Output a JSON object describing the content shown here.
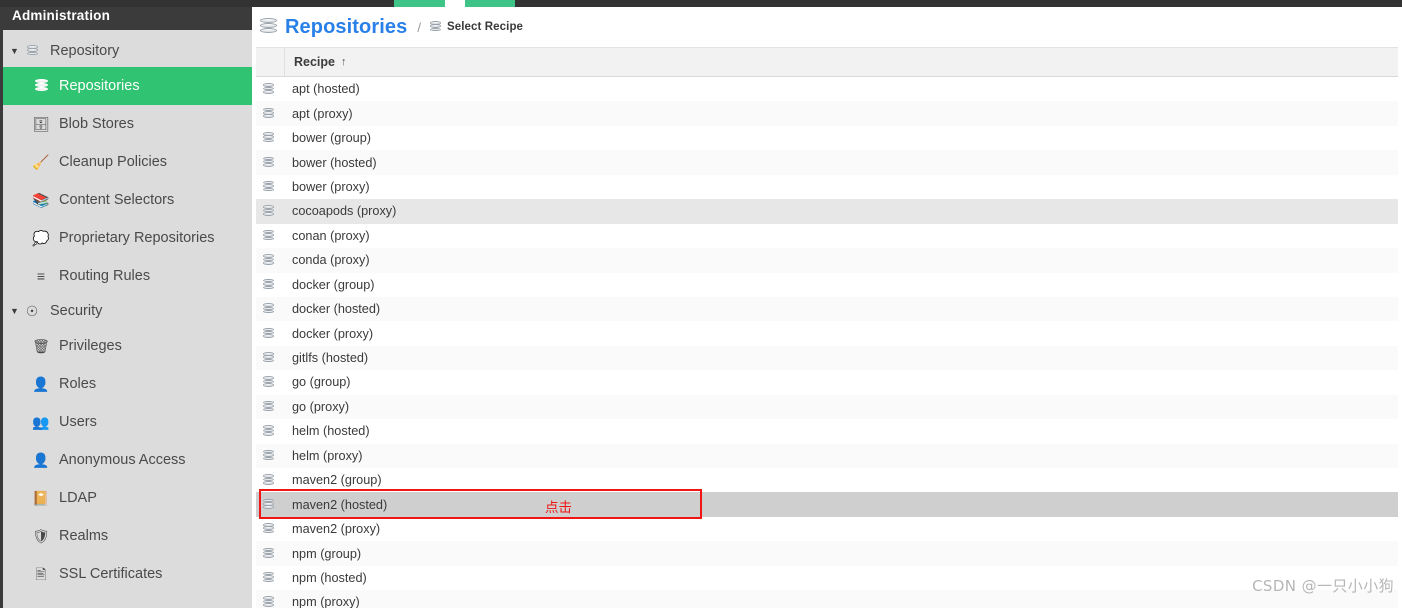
{
  "sidebar": {
    "title": "Administration",
    "groups": [
      {
        "label": "Repository",
        "icon": "database-icon",
        "expanded": true,
        "items": [
          {
            "label": "Repositories",
            "icon": "database-icon",
            "active": true
          },
          {
            "label": "Blob Stores",
            "icon": "blob-store-icon",
            "active": false
          },
          {
            "label": "Cleanup Policies",
            "icon": "broom-icon",
            "active": false
          },
          {
            "label": "Content Selectors",
            "icon": "layers-icon",
            "active": false
          },
          {
            "label": "Proprietary Repositories",
            "icon": "proprietary-icon",
            "active": false
          },
          {
            "label": "Routing Rules",
            "icon": "routing-icon",
            "active": false
          }
        ]
      },
      {
        "label": "Security",
        "icon": "security-icon",
        "expanded": true,
        "items": [
          {
            "label": "Privileges",
            "icon": "privileges-icon",
            "active": false
          },
          {
            "label": "Roles",
            "icon": "roles-icon",
            "active": false
          },
          {
            "label": "Users",
            "icon": "users-icon",
            "active": false
          },
          {
            "label": "Anonymous Access",
            "icon": "anonymous-user-icon",
            "active": false
          },
          {
            "label": "LDAP",
            "icon": "ldap-book-icon",
            "active": false
          },
          {
            "label": "Realms",
            "icon": "shield-icon",
            "active": false
          },
          {
            "label": "SSL Certificates",
            "icon": "certificate-icon",
            "active": false
          }
        ]
      }
    ]
  },
  "breadcrumb": {
    "icon": "database-icon",
    "title": "Repositories",
    "separator": "/",
    "sub_icon": "database-icon",
    "sub_label": "Select Recipe"
  },
  "table": {
    "column_header": "Recipe",
    "sort_indicator": "↑",
    "row_icon": "database-icon",
    "rows": [
      {
        "label": "apt (hosted)",
        "state": "normal"
      },
      {
        "label": "apt (proxy)",
        "state": "alt"
      },
      {
        "label": "bower (group)",
        "state": "normal"
      },
      {
        "label": "bower (hosted)",
        "state": "alt"
      },
      {
        "label": "bower (proxy)",
        "state": "normal"
      },
      {
        "label": "cocoapods (proxy)",
        "state": "hover"
      },
      {
        "label": "conan (proxy)",
        "state": "normal"
      },
      {
        "label": "conda (proxy)",
        "state": "alt"
      },
      {
        "label": "docker (group)",
        "state": "normal"
      },
      {
        "label": "docker (hosted)",
        "state": "alt"
      },
      {
        "label": "docker (proxy)",
        "state": "normal"
      },
      {
        "label": "gitlfs (hosted)",
        "state": "alt"
      },
      {
        "label": "go (group)",
        "state": "normal"
      },
      {
        "label": "go (proxy)",
        "state": "alt"
      },
      {
        "label": "helm (hosted)",
        "state": "normal"
      },
      {
        "label": "helm (proxy)",
        "state": "alt"
      },
      {
        "label": "maven2 (group)",
        "state": "normal"
      },
      {
        "label": "maven2 (hosted)",
        "state": "selected"
      },
      {
        "label": "maven2 (proxy)",
        "state": "normal"
      },
      {
        "label": "npm (group)",
        "state": "alt"
      },
      {
        "label": "npm (hosted)",
        "state": "normal"
      },
      {
        "label": "npm (proxy)",
        "state": "alt"
      }
    ]
  },
  "annotation": {
    "text": "点击",
    "color": "#f01616",
    "target_row": "maven2 (hosted)"
  },
  "watermark": {
    "text": "CSDN @一只小小狗"
  },
  "colors": {
    "active_nav": "#30c472",
    "breadcrumb_link": "#2980e8",
    "sidebar_bg": "#dcdcdc",
    "title_bar": "#3b3b3b",
    "tab_green": "#3ec487"
  }
}
